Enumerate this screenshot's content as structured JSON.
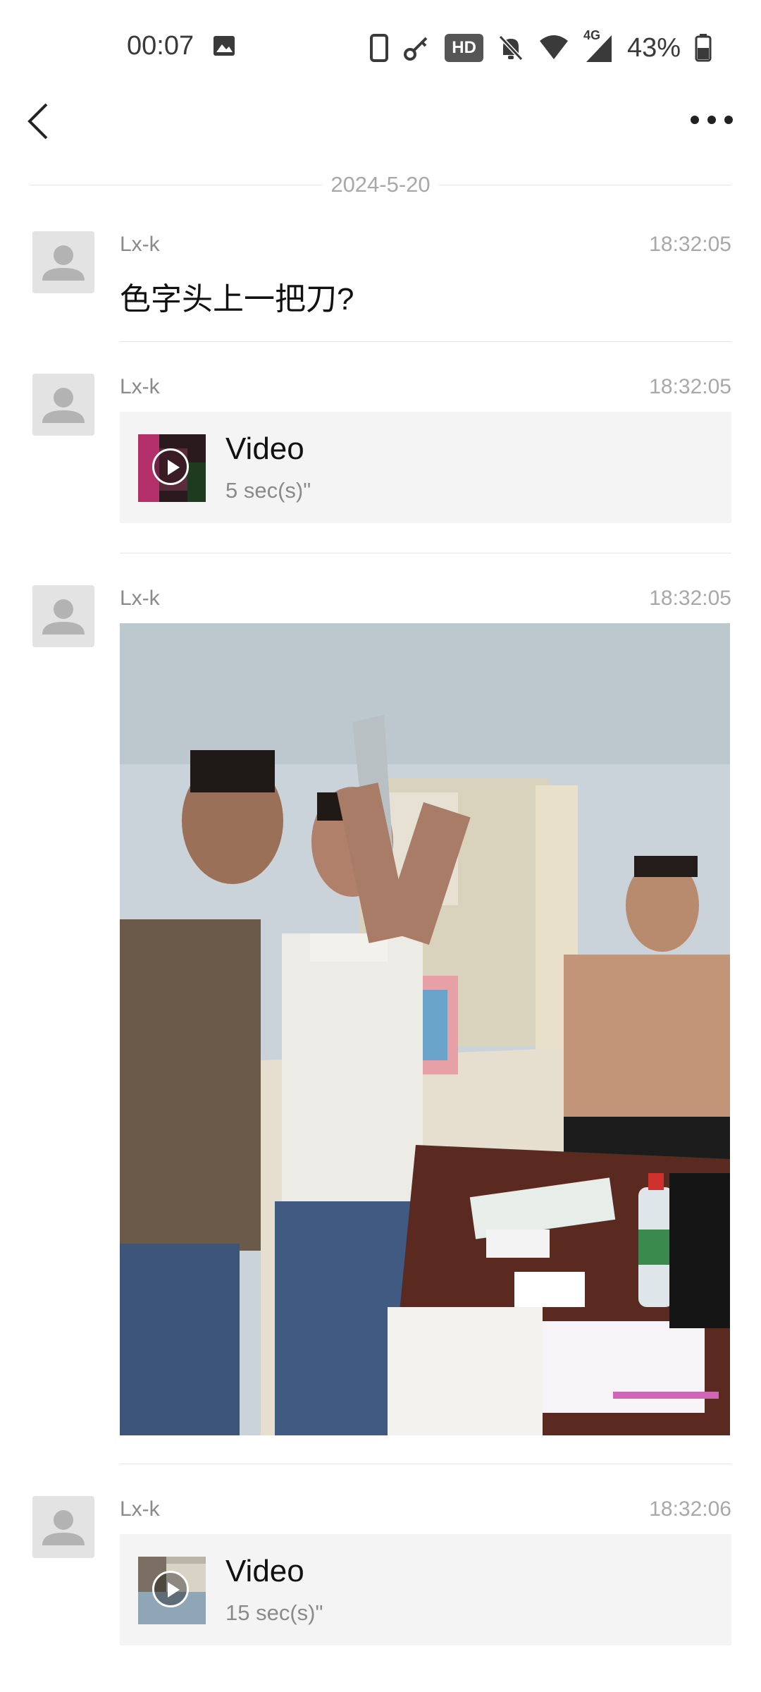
{
  "status_bar": {
    "time": "00:07",
    "battery_pct": "43%",
    "hd_badge": "HD",
    "network_label": "4G",
    "icons": [
      "image-icon",
      "phone-icon",
      "key-icon",
      "hd-icon",
      "mute-bell-icon",
      "wifi-icon",
      "signal-icon",
      "battery-icon"
    ]
  },
  "header": {
    "back_icon": "chevron-left-icon",
    "more_icon": "more-dots-icon"
  },
  "date_separator": "2024-5-20",
  "messages": [
    {
      "sender": "Lx-k",
      "time": "18:32:05",
      "type": "text",
      "text": "色字头上一把刀?"
    },
    {
      "sender": "Lx-k",
      "time": "18:32:05",
      "type": "video",
      "title": "Video",
      "duration": "5 sec(s)\""
    },
    {
      "sender": "Lx-k",
      "time": "18:32:05",
      "type": "image"
    },
    {
      "sender": "Lx-k",
      "time": "18:32:06",
      "type": "video",
      "title": "Video",
      "duration": "15 sec(s)\""
    }
  ],
  "colors": {
    "background": "#ffffff",
    "card": "#f4f4f4",
    "secondary_text": "#8a8a8a",
    "divider": "#e6e6e6"
  }
}
